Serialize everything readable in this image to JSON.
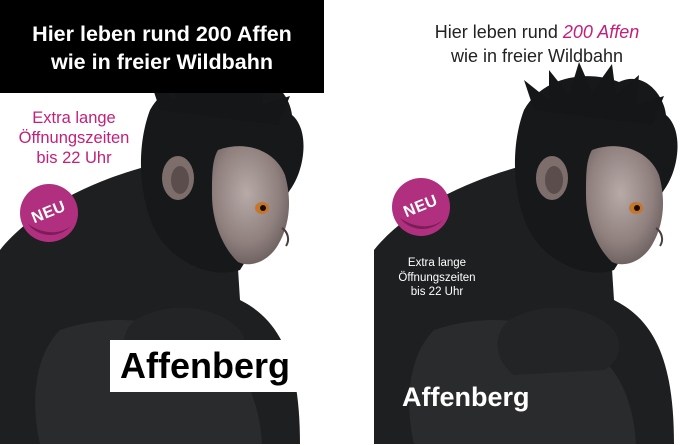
{
  "left_poster": {
    "headline_line1": "Hier leben rund 200 Affen",
    "headline_line2": "wie in freier Wildbahn",
    "hours_line1": "Extra lange",
    "hours_line2": "Öffnungszeiten",
    "hours_line3": "bis 22 Uhr",
    "badge": "NEU",
    "brand": "Affenberg"
  },
  "right_poster": {
    "headline_part1": "Hier leben rund ",
    "headline_accent": "200 Affen",
    "headline_line2": "wie in freier Wildbahn",
    "hours_line1": "Extra lange",
    "hours_line2": "Öffnungszeiten",
    "hours_line3": "bis 22 Uhr",
    "badge": "NEU",
    "brand": "Affenberg"
  },
  "colors": {
    "accent": "#c2207b",
    "badge": "#b0307f",
    "fur": "#1b1c1d"
  }
}
